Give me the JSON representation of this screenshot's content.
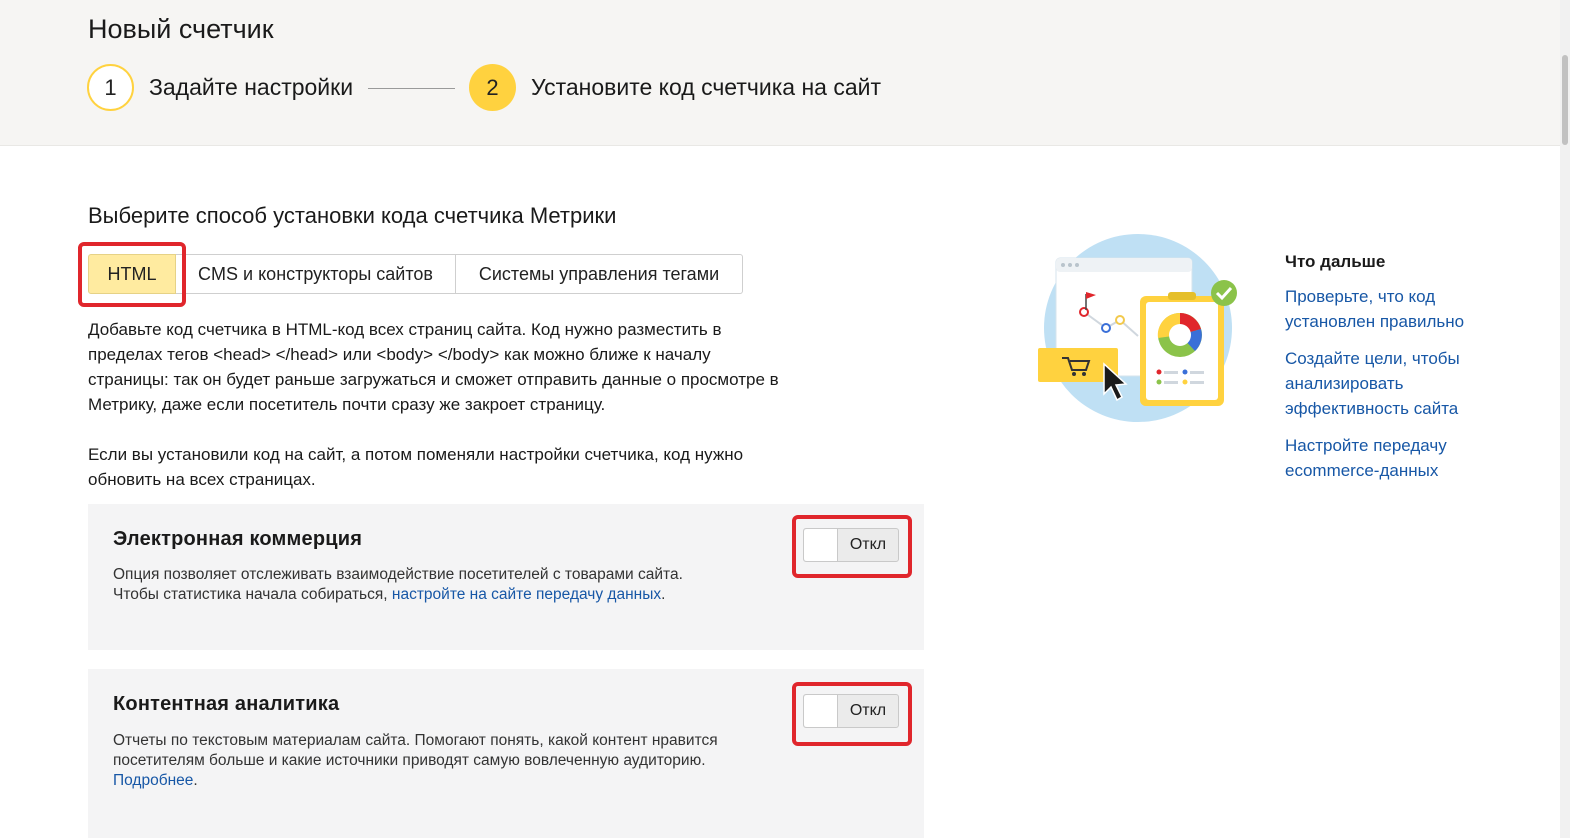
{
  "header": {
    "title": "Новый счетчик",
    "steps": [
      {
        "number": "1",
        "label": "Задайте настройки"
      },
      {
        "number": "2",
        "label": "Установите код счетчика на сайт"
      }
    ]
  },
  "install": {
    "section_title": "Выберите способ установки кода счетчика Метрики",
    "tabs": [
      {
        "label": "HTML",
        "selected": true
      },
      {
        "label": "CMS и конструкторы сайтов",
        "selected": false
      },
      {
        "label": "Системы управления тегами",
        "selected": false
      }
    ],
    "para1_lines": [
      "Добавьте код счетчика в HTML-код всех страниц сайта. Код нужно разместить в",
      "пределах тегов <head> </head> или <body> </body> как можно ближе к началу",
      "страницы: так он будет раньше загружаться и сможет отправить данные о просмотре в",
      "Метрику, даже если посетитель почти сразу же закроет страницу."
    ],
    "para2_lines": [
      "Если вы установили код на сайт, а потом поменяли настройки счетчика, код нужно",
      "обновить на всех страницах."
    ]
  },
  "ecommerce": {
    "title": "Электронная коммерция",
    "text_line1": "Опция позволяет отслеживать взаимодействие посетителей с товарами сайта.",
    "text_line2_prefix": "Чтобы статистика начала собираться, ",
    "link": "настройте на сайте передачу данных",
    "text_line2_suffix": ".",
    "toggle_label": "Откл"
  },
  "content_analytics": {
    "title": "Контентная аналитика",
    "text_line1": "Отчеты по текстовым материалам сайта. Помогают понять, какой контент нравится",
    "text_line2": "посетителям больше и какие источники приводят самую вовлеченную аудиторию.",
    "link": "Подробнее",
    "link_suffix": ".",
    "toggle_label": "Откл"
  },
  "aside": {
    "title": "Что дальше",
    "links": [
      {
        "line1": "Проверьте, что код",
        "line2": "установлен правильно"
      },
      {
        "line1": "Создайте цели, чтобы",
        "line2": "анализировать",
        "line3": "эффективность сайта"
      },
      {
        "line1": "Настройте передачу",
        "line2": "ecommerce-данных"
      }
    ]
  },
  "colors": {
    "accent_yellow": "#ffd23f",
    "selected_tab": "#ffeba0",
    "link_blue": "#1757a6",
    "highlight_red": "#e0262c"
  }
}
